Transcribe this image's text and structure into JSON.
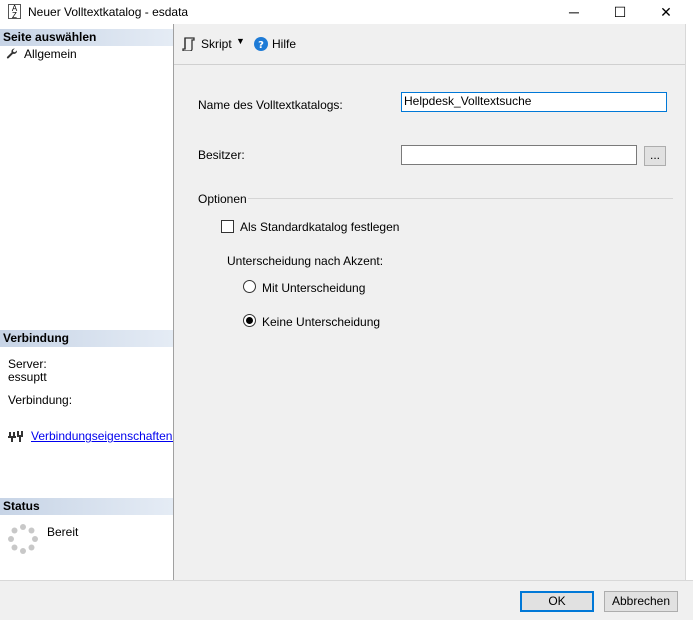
{
  "window": {
    "title": "Neuer Volltextkatalog - esdata",
    "app_icon_text": "A Z",
    "minimize": "─",
    "maximize": "☐",
    "close": "✕"
  },
  "sidebar": {
    "select_page_header": "Seite auswählen",
    "pages": [
      {
        "label": "Allgemein",
        "icon": "wrench-icon"
      }
    ],
    "connection_header": "Verbindung",
    "server_label": "Server:",
    "server_value": "essuptt",
    "connection_label": "Verbindung:",
    "connection_value": "",
    "connection_link": "Verbindungseigenschaften anzeigen",
    "status_header": "Status",
    "status_text": "Bereit"
  },
  "toolbar": {
    "script_label": "Skript",
    "help_label": "Hilfe"
  },
  "form": {
    "catalog_name_label": "Name des Volltextkatalogs:",
    "catalog_name_value": "Helpdesk_Volltextsuche",
    "owner_label": "Besitzer:",
    "owner_value": "",
    "browse_label": "...",
    "options_label": "Optionen",
    "default_catalog_label": "Als Standardkatalog festlegen",
    "default_catalog_checked": false,
    "accent_label": "Unterscheidung nach Akzent:",
    "accent_options": [
      {
        "label": "Mit Unterscheidung",
        "selected": false
      },
      {
        "label": "Keine Unterscheidung",
        "selected": true
      }
    ]
  },
  "footer": {
    "ok_label": "OK",
    "cancel_label": "Abbrechen"
  }
}
